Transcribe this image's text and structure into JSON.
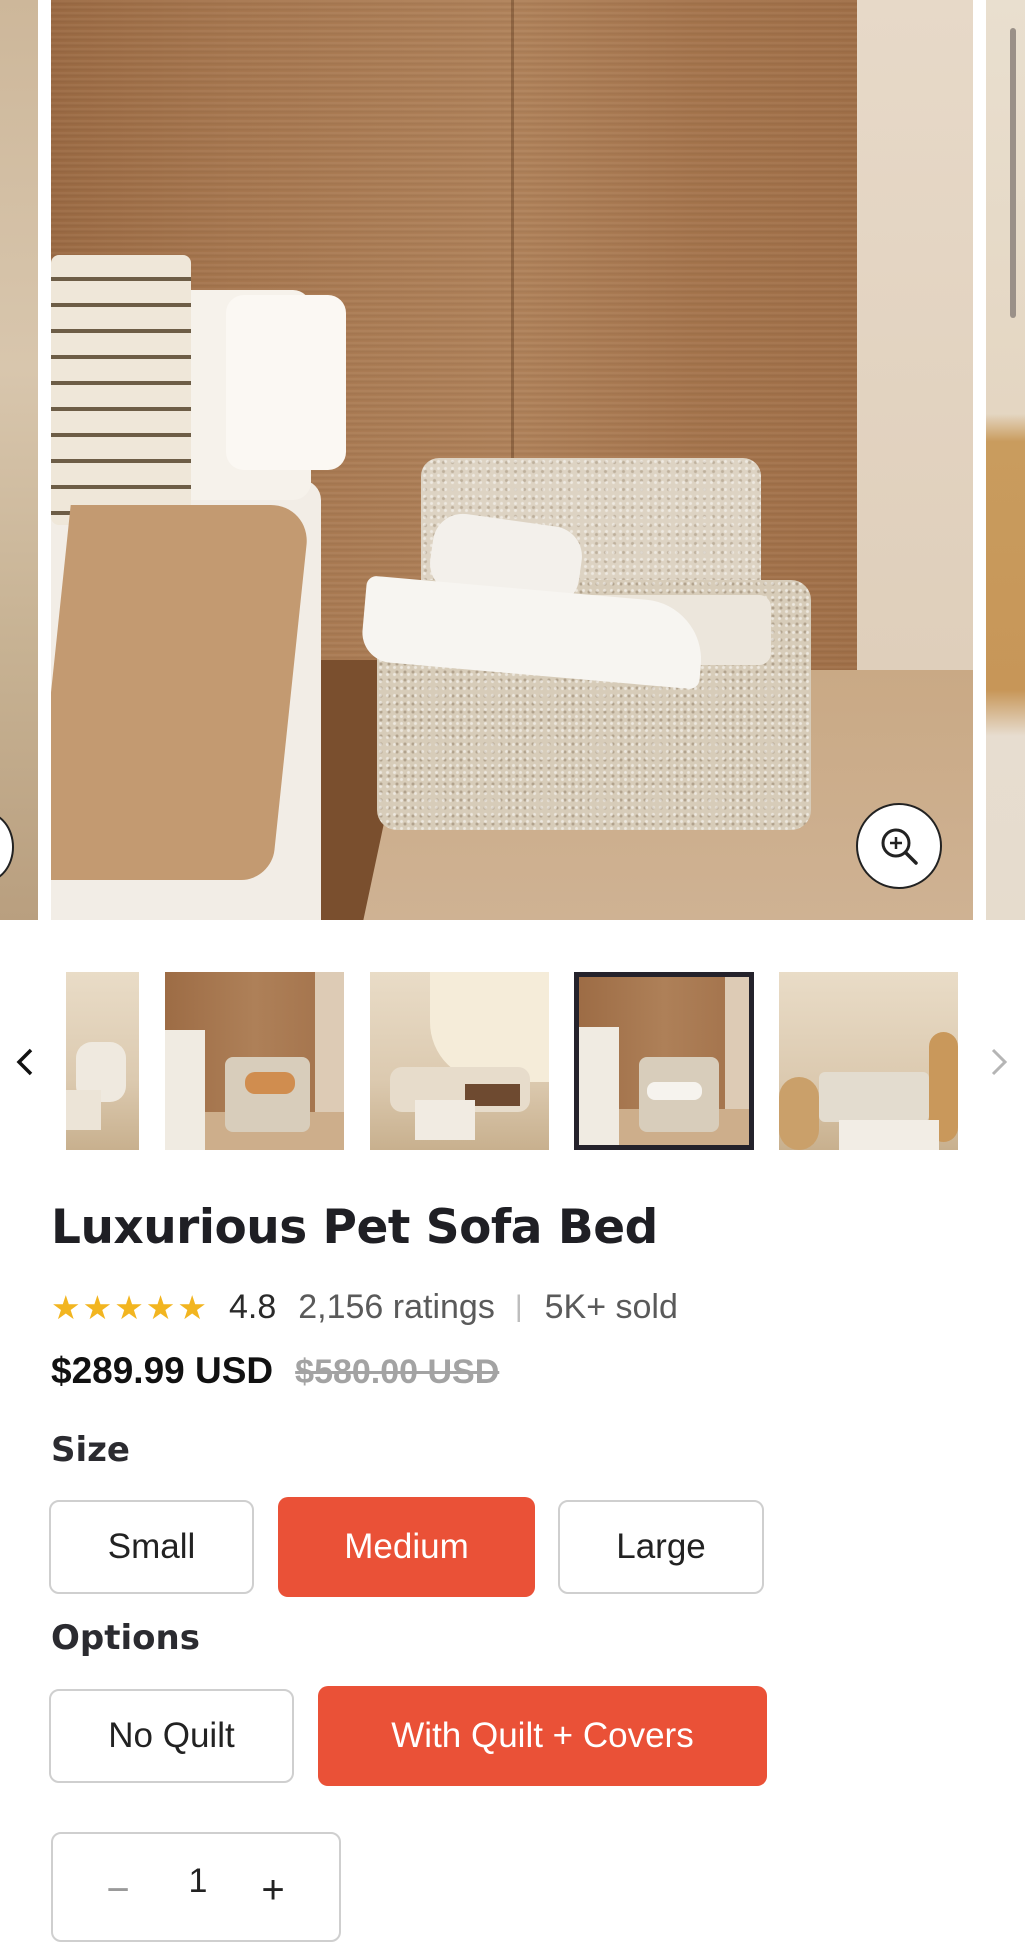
{
  "product": {
    "title": "Luxurious Pet Sofa Bed",
    "rating_value": "4.8",
    "stars_filled": 5,
    "ratings_count": "2,156 ratings",
    "separator": "|",
    "sold": "5K+ sold",
    "price": "$289.99 USD",
    "compare_price": "$580.00 USD"
  },
  "size": {
    "label": "Size",
    "options": [
      "Small",
      "Medium",
      "Large"
    ],
    "selected": "Medium"
  },
  "options": {
    "label": "Options",
    "choices": [
      "No Quilt",
      "With Quilt + Covers"
    ],
    "selected": "With Quilt + Covers"
  },
  "quantity": {
    "value": "1",
    "minus": "−",
    "plus": "+"
  },
  "gallery": {
    "selected_thumbnail": 4,
    "prev_icon": "chevron-left-icon",
    "next_icon": "chevron-right-icon",
    "zoom_icon": "zoom-in-icon"
  },
  "colors": {
    "accent": "#ea5137",
    "star": "#f2b520",
    "thumb_selected_border": "#24222b"
  }
}
